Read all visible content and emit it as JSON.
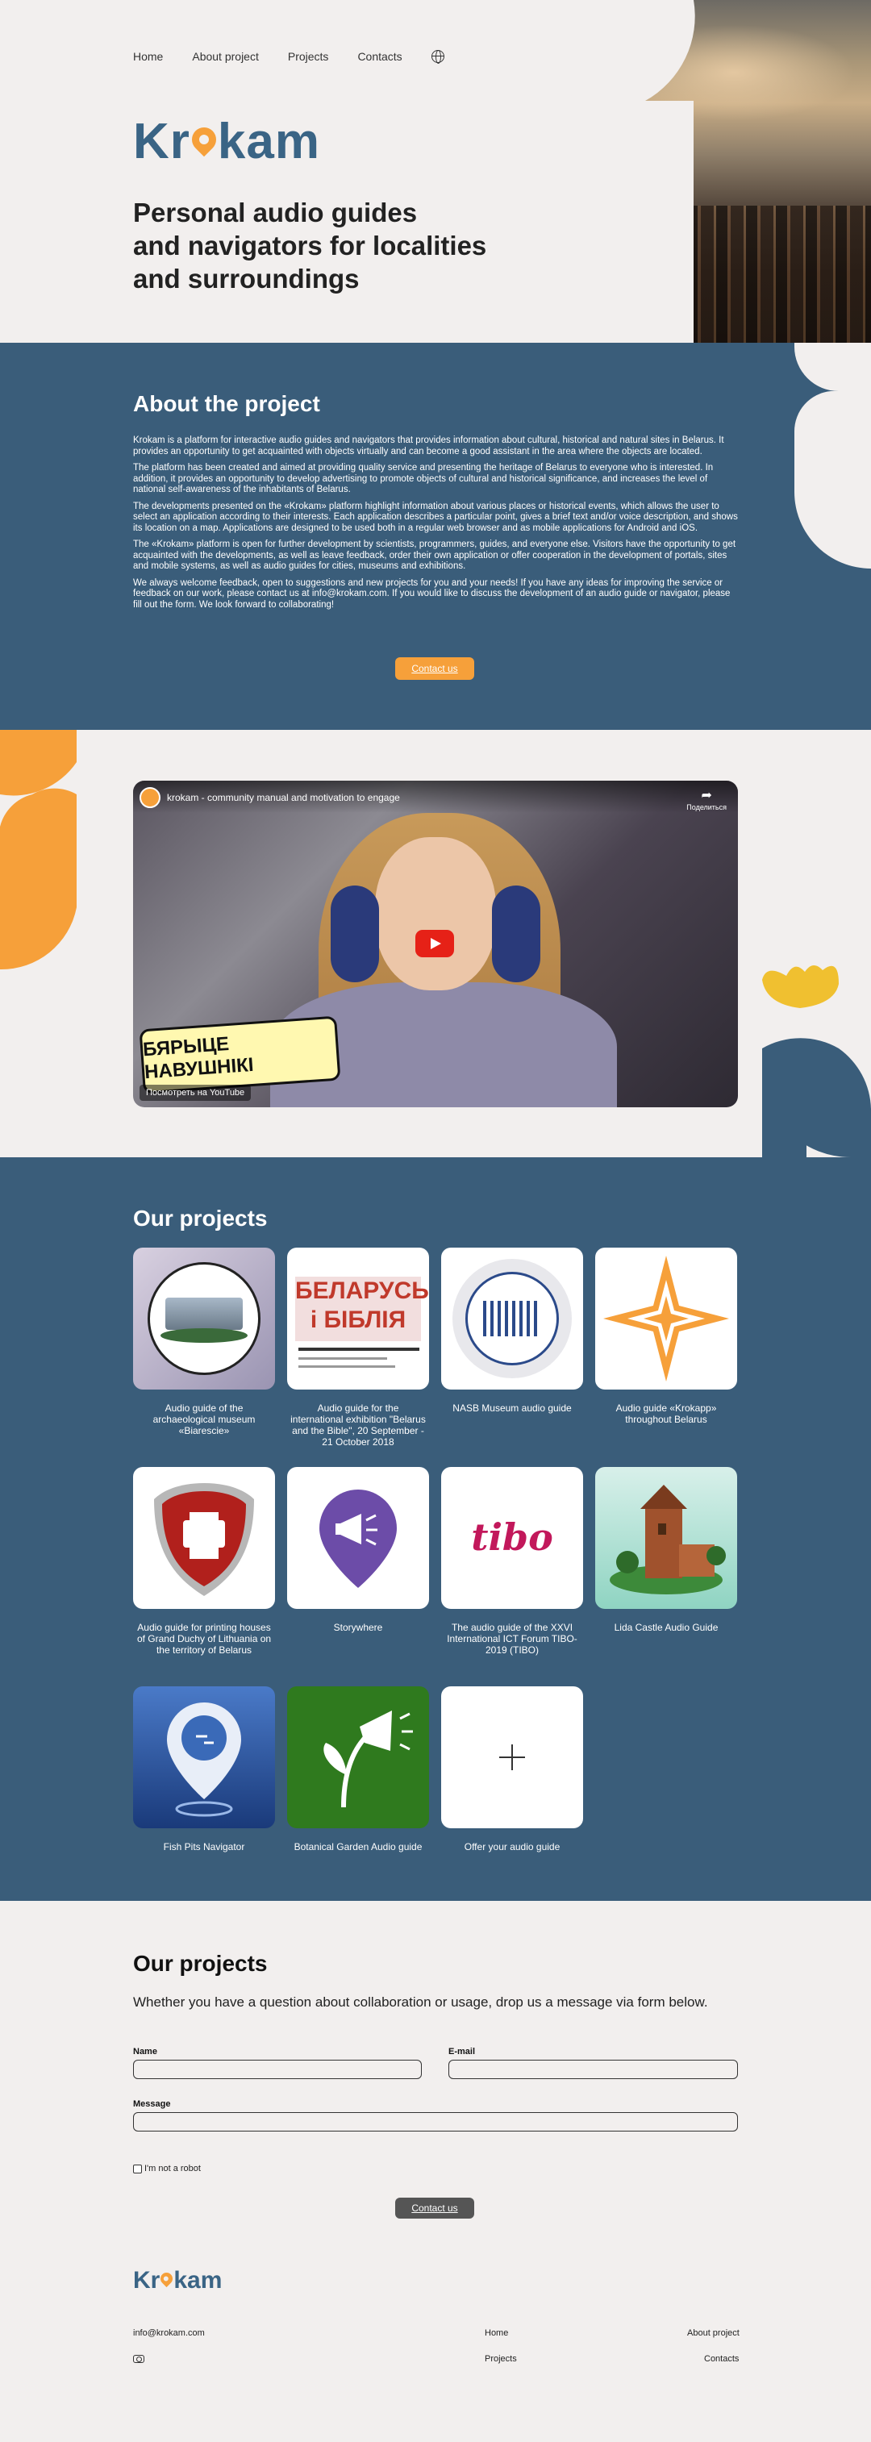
{
  "nav": {
    "items": [
      "Home",
      "About project",
      "Projects",
      "Contacts"
    ],
    "language_icon": "globe-icon"
  },
  "brand": {
    "name_prefix": "Kr",
    "name_suffix": "kam",
    "pin_icon": "map-pin-icon"
  },
  "hero": {
    "title_lines": [
      "Personal audio guides",
      "and navigators for localities",
      "and surroundings"
    ]
  },
  "about": {
    "title": "About the project",
    "paragraphs": [
      "Krokam is a platform for interactive audio guides and navigators that provides information about cultural, historical and natural sites in Belarus. It provides an opportunity to get acquainted with objects virtually and can become a good assistant in the area where the objects are located.",
      "The platform has been created and aimed at providing quality service and presenting the heritage of Belarus to everyone who is interested. In addition, it provides an opportunity to develop advertising to promote objects of cultural and historical significance, and increases the level of national self-awareness of the inhabitants of Belarus.",
      "The developments presented on the «Krokam» platform highlight information about various places or historical events, which allows the user to select an application according to their interests. Each application describes a particular point, gives a brief text and/or voice description, and shows its location on a map. Applications are designed to be used both in a regular web browser and as mobile applications for Android and iOS.",
      "The «Krokam» platform is open for further development by scientists, programmers, guides, and everyone else. Visitors have the opportunity to get acquainted with the developments, as well as leave feedback, order their own application or offer cooperation in the development of portals, sites and mobile systems, as well as audio guides for cities, museums and exhibitions.",
      "We always welcome feedback, open to suggestions and new projects for you and your needs! If you have any ideas for improving the service or feedback on our work, please contact us at info@krokam.com. If you would like to discuss the development of an audio guide or navigator, please fill out the form. We look forward to collaborating!"
    ],
    "button": "Contact us"
  },
  "video": {
    "title": "krokam - community manual and motivation to engage",
    "share_label": "Поделиться",
    "sticker_text": "БЯРЫЦЕ НАВУШНІКІ",
    "watch_label": "Посмотреть на YouTube"
  },
  "projects": {
    "title": "Our projects",
    "items": [
      {
        "caption": "Audio guide of the archaeological museum «Biarescie»"
      },
      {
        "caption": "Audio guide for the international exhibition \"Belarus and the Bible\", 20 September - 21 October 2018",
        "thumb_title": "БЕЛАРУСЬ і БІБЛІЯ"
      },
      {
        "caption": "NASB Museum audio guide"
      },
      {
        "caption": "Audio guide «Krokapp» throughout Belarus"
      },
      {
        "caption": "Audio guide for printing houses of Grand Duchy of Lithuania on the territory of Belarus"
      },
      {
        "caption": "Storywhere"
      },
      {
        "caption": "The audio guide of the XXVI International ICT Forum TIBO-2019 (TIBO)",
        "thumb_title": "tibo"
      },
      {
        "caption": "Lida Castle Audio Guide"
      },
      {
        "caption": "Fish Pits Navigator"
      },
      {
        "caption": "Botanical Garden Audio guide"
      },
      {
        "caption": "Offer your audio guide"
      }
    ]
  },
  "contact": {
    "title": "Our projects",
    "subtitle": "Whether you have a question about collaboration or usage, drop us a message via form below.",
    "name_label": "Name",
    "email_label": "E-mail",
    "message_label": "Message",
    "captcha_label": "I'm not a robot",
    "submit": "Contact us"
  },
  "footer": {
    "email": "info@krokam.com",
    "links": [
      "Home",
      "About project",
      "Projects",
      "Contacts"
    ],
    "social_icon": "camera-icon"
  },
  "colors": {
    "primary": "#3a5d7a",
    "accent": "#f6a03a",
    "background": "#f2efee",
    "yellow": "#f0c030"
  }
}
